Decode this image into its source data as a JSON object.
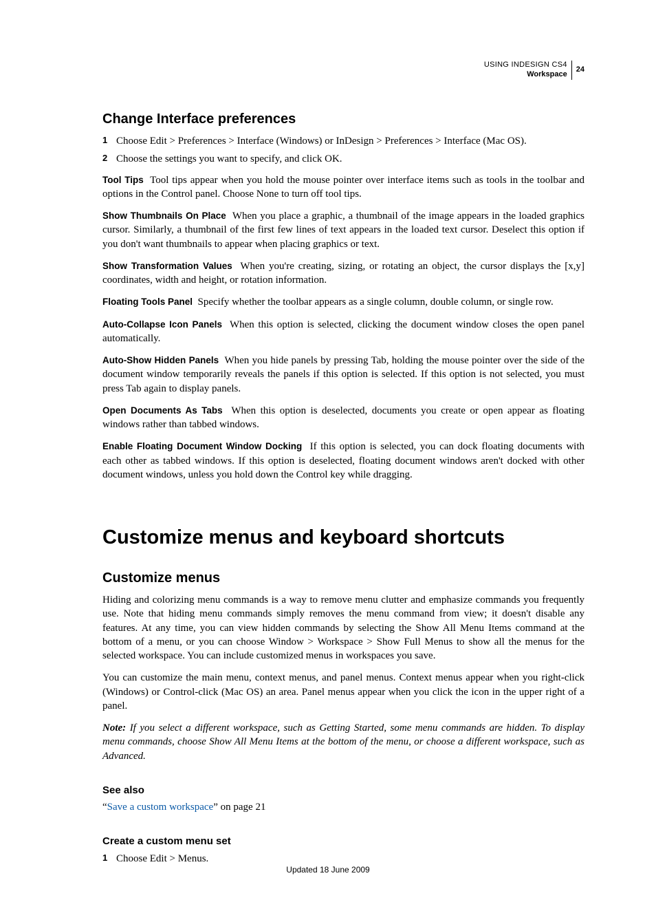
{
  "header": {
    "line1": "USING INDESIGN CS4",
    "line2": "Workspace",
    "page_number": "24"
  },
  "section1": {
    "title": "Change Interface preferences",
    "steps": [
      "Choose Edit > Preferences > Interface (Windows) or InDesign > Preferences > Interface (Mac OS).",
      "Choose the settings you want to specify, and click OK."
    ],
    "defs": [
      {
        "term": "Tool Tips",
        "body": "Tool tips appear when you hold the mouse pointer over interface items such as tools in the toolbar and options in the Control panel. Choose None to turn off tool tips."
      },
      {
        "term": "Show Thumbnails On Place",
        "body": "When you place a graphic, a thumbnail of the image appears in the loaded graphics cursor. Similarly, a thumbnail of the first few lines of text appears in the loaded text cursor. Deselect this option if you don't want thumbnails to appear when placing graphics or text."
      },
      {
        "term": "Show Transformation Values",
        "body": "When you're creating, sizing, or rotating an object, the cursor displays the [x,y] coordinates, width and height, or rotation information."
      },
      {
        "term": "Floating Tools Panel",
        "body": "Specify whether the toolbar appears as a single column, double column, or single row."
      },
      {
        "term": "Auto-Collapse Icon Panels",
        "body": "When this option is selected, clicking the document window closes the open panel automatically."
      },
      {
        "term": "Auto-Show Hidden Panels",
        "body": "When you hide panels by pressing Tab, holding the mouse pointer over the side of the document window temporarily reveals the panels if this option is selected. If this option is not selected, you must press Tab again to display panels."
      },
      {
        "term": "Open Documents As Tabs",
        "body": "When this option is deselected, documents you create or open appear as floating windows rather than tabbed windows."
      },
      {
        "term": "Enable Floating Document Window Docking",
        "body": "If this option is selected, you can dock floating documents with each other as tabbed windows. If this option is deselected, floating document windows aren't docked with other document windows, unless you hold down the Control key while dragging."
      }
    ]
  },
  "chapter": {
    "title": "Customize menus and keyboard shortcuts"
  },
  "section2": {
    "title": "Customize menus",
    "paras": [
      "Hiding and colorizing menu commands is a way to remove menu clutter and emphasize commands you frequently use. Note that hiding menu commands simply removes the menu command from view; it doesn't disable any features. At any time, you can view hidden commands by selecting the Show All Menu Items command at the bottom of a menu, or you can choose Window > Workspace > Show Full Menus to show all the menus for the selected workspace. You can include customized menus in workspaces you save.",
      "You can customize the main menu, context menus, and panel menus. Context menus appear when you right-click (Windows) or Control-click (Mac OS) an area. Panel menus appear when you click the icon in the upper right of a panel."
    ],
    "note": {
      "label": "Note:",
      "body": "If you select a different workspace, such as Getting Started, some menu commands are hidden. To display menu commands, choose Show All Menu Items at the bottom of the menu, or choose a different workspace, such as Advanced."
    }
  },
  "see_also": {
    "heading": "See also",
    "quote_open": "“",
    "link_text": "Save a custom workspace",
    "tail": "” on page 21"
  },
  "section3": {
    "title": "Create a custom menu set",
    "steps": [
      "Choose Edit > Menus."
    ]
  },
  "footer": {
    "updated": "Updated 18 June 2009"
  }
}
